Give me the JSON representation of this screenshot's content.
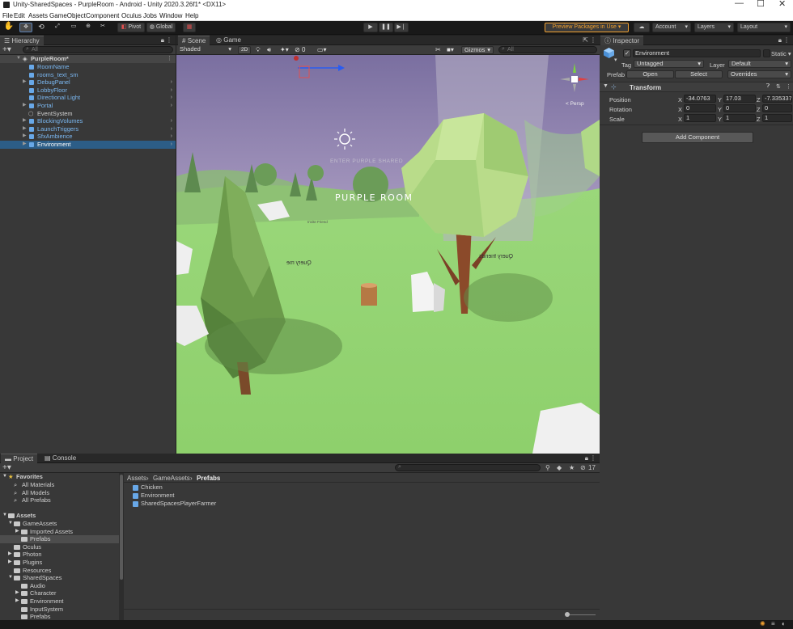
{
  "window": {
    "title": "Unity-SharedSpaces - PurpleRoom - Android - Unity 2020.3.26f1* <DX11>",
    "controls": [
      "—",
      "☐",
      "✕"
    ]
  },
  "menu": [
    "File",
    "Edit",
    "Assets",
    "GameObject",
    "Component",
    "Oculus",
    "Jobs",
    "Window",
    "Help"
  ],
  "toolbar": {
    "pivot_label": "Pivot",
    "global_label": "Global",
    "preview_packages_label": "Preview Packages in Use",
    "account_label": "Account",
    "layers_label": "Layers",
    "layout_label": "Layout"
  },
  "hierarchy": {
    "tab_label": "Hierarchy",
    "search_placeholder": "All",
    "root": "PurpleRoom*",
    "items": [
      {
        "label": "RoomName",
        "expandable": false,
        "chevron": false
      },
      {
        "label": "rooms_text_sm",
        "expandable": false,
        "chevron": false
      },
      {
        "label": "DebugPanel",
        "expandable": true,
        "chevron": true
      },
      {
        "label": "LobbyFloor",
        "expandable": false,
        "chevron": true
      },
      {
        "label": "Directional Light",
        "expandable": false,
        "chevron": true
      },
      {
        "label": "Portal",
        "expandable": true,
        "chevron": true
      },
      {
        "label": "EventSystem",
        "expandable": false,
        "chevron": false
      },
      {
        "label": "BlockingVolumes",
        "expandable": true,
        "chevron": true
      },
      {
        "label": "LaunchTriggers",
        "expandable": true,
        "chevron": true
      },
      {
        "label": "SfxAmbience",
        "expandable": true,
        "chevron": true
      },
      {
        "label": "Environment",
        "expandable": true,
        "chevron": true
      }
    ],
    "selected": "Environment"
  },
  "scene_view": {
    "tabs": [
      "Scene",
      "Game"
    ],
    "shading_mode": "Shaded",
    "mode_2d": "2D",
    "gizmos_label": "Gizmos",
    "search_placeholder": "All",
    "hidden_count": "0",
    "perspective_label": "< Persp",
    "world_text": {
      "room_title": "PURPLE ROOM",
      "top_label": "ENTER PURPLE SHARED",
      "small_label": "Invite Friend",
      "query_me": "Query me",
      "query_friends": "Query friends"
    }
  },
  "inspector": {
    "tab_label": "Inspector",
    "object_name": "Environment",
    "static_label": "Static",
    "tag_label": "Tag",
    "tag_value": "Untagged",
    "layer_label": "Layer",
    "layer_value": "Default",
    "prefab_label": "Prefab",
    "open_label": "Open",
    "select_label": "Select",
    "overrides_label": "Overrides",
    "transform_title": "Transform",
    "position": {
      "label": "Position",
      "x": "-34.0763",
      "y": "17.03",
      "z": "-7.335337"
    },
    "rotation": {
      "label": "Rotation",
      "x": "0",
      "y": "0",
      "z": "0"
    },
    "scale": {
      "label": "Scale",
      "x": "1",
      "y": "1",
      "z": "1"
    },
    "add_component_label": "Add Component"
  },
  "project": {
    "tabs": [
      "Project",
      "Console"
    ],
    "hidden_count": "17",
    "breadcrumb": [
      "Assets",
      "GameAssets",
      "Prefabs"
    ],
    "favorites_label": "Favorites",
    "favorites": [
      "All Materials",
      "All Models",
      "All Prefabs"
    ],
    "assets_label": "Assets",
    "tree": [
      {
        "label": "GameAssets",
        "depth": 1,
        "arrow": "▼"
      },
      {
        "label": "Imported Assets",
        "depth": 2,
        "arrow": "▶"
      },
      {
        "label": "Prefabs",
        "depth": 2,
        "arrow": "",
        "selected": true
      },
      {
        "label": "Oculus",
        "depth": 1,
        "arrow": ""
      },
      {
        "label": "Photon",
        "depth": 1,
        "arrow": "▶"
      },
      {
        "label": "Plugins",
        "depth": 1,
        "arrow": "▶"
      },
      {
        "label": "Resources",
        "depth": 1,
        "arrow": ""
      },
      {
        "label": "SharedSpaces",
        "depth": 1,
        "arrow": "▼"
      },
      {
        "label": "Audio",
        "depth": 2,
        "arrow": ""
      },
      {
        "label": "Character",
        "depth": 2,
        "arrow": "▶"
      },
      {
        "label": "Environment",
        "depth": 2,
        "arrow": "▶"
      },
      {
        "label": "InputSystem",
        "depth": 2,
        "arrow": ""
      },
      {
        "label": "Prefabs",
        "depth": 2,
        "arrow": ""
      }
    ],
    "files": [
      "Chicken",
      "Environment",
      "SharedSpacesPlayerFarmer"
    ]
  },
  "colors": {
    "selection": "#2c5d87",
    "prefab_blue": "#7bb8f2",
    "preview_orange": "#f0a030",
    "sky_top": "#7a6fa0",
    "ground": "#8fcf6f"
  }
}
